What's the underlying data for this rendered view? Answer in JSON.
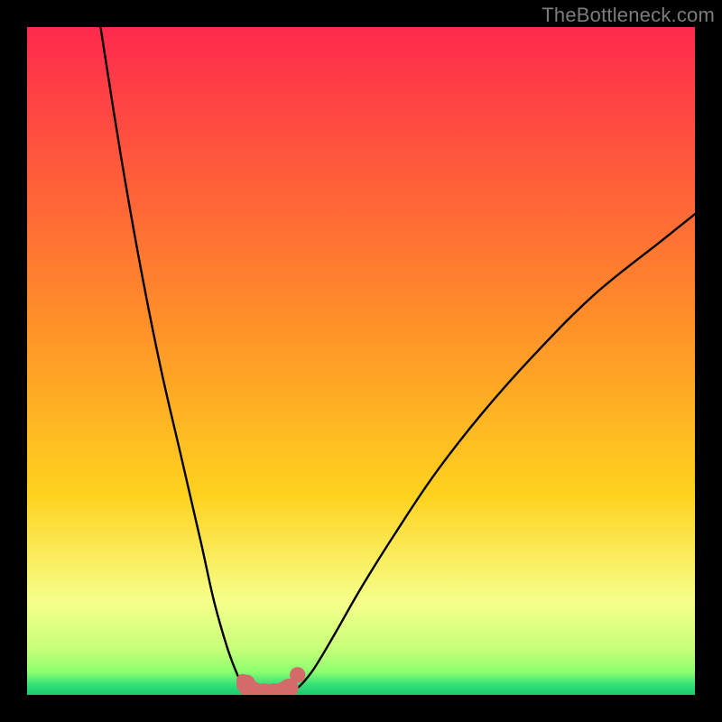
{
  "watermark": "TheBottleneck.com",
  "colors": {
    "black": "#000000",
    "curve_black": "#000000",
    "marker_fill": "#d46a6a",
    "marker_stroke": "#b84f4f",
    "gradient_top": "#ff2a4d",
    "gradient_mid": "#ffd21e",
    "gradient_low": "#f6ff8a",
    "gradient_green1": "#8eff6f",
    "gradient_green2": "#33e07a",
    "gradient_bottom": "#19c96d"
  },
  "chart_data": {
    "type": "line",
    "title": "",
    "xlabel": "",
    "ylabel": "",
    "xlim": [
      0,
      100
    ],
    "ylim": [
      0,
      100
    ],
    "series": [
      {
        "name": "left-curve",
        "x": [
          11,
          14,
          17,
          20,
          23,
          26,
          28,
          30,
          31.5,
          32.5,
          33.5
        ],
        "y": [
          100,
          81,
          64,
          49,
          36,
          23,
          14,
          7,
          3,
          1.2,
          0.4
        ]
      },
      {
        "name": "right-curve",
        "x": [
          39.5,
          41,
          43,
          46,
          50,
          55,
          61,
          68,
          76,
          85,
          95,
          100
        ],
        "y": [
          0.4,
          1.5,
          4,
          9,
          16,
          24,
          33,
          42,
          51,
          60,
          68,
          72
        ]
      },
      {
        "name": "flat-bottom",
        "x": [
          33.5,
          34.5,
          36,
          37.5,
          39,
          39.5
        ],
        "y": [
          0.4,
          0.2,
          0.15,
          0.15,
          0.2,
          0.4
        ]
      }
    ],
    "markers": [
      {
        "x": 32.8,
        "y": 1.6,
        "r": 1.0
      },
      {
        "x": 33.3,
        "y": 0.9,
        "r": 1.0
      },
      {
        "x": 34.0,
        "y": 0.5,
        "r": 1.0
      },
      {
        "x": 35.5,
        "y": 0.3,
        "r": 1.0
      },
      {
        "x": 37.0,
        "y": 0.3,
        "r": 1.0
      },
      {
        "x": 38.3,
        "y": 0.5,
        "r": 1.0
      },
      {
        "x": 39.2,
        "y": 1.0,
        "r": 1.0
      },
      {
        "x": 40.5,
        "y": 3.0,
        "r": 0.7
      }
    ]
  }
}
